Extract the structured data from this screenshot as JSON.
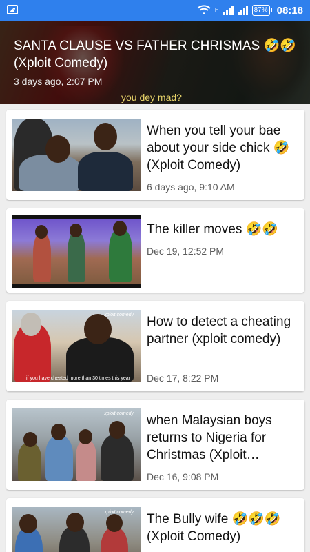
{
  "status_bar": {
    "battery": "87%",
    "time": "08:18",
    "network_label": "H"
  },
  "featured": {
    "title": "SANTA CLAUSE  VS  FATHER CHRISMAS 🤣🤣 (Xploit Comedy)",
    "time": "3 days ago, 2:07 PM",
    "caption": "you dey mad?"
  },
  "videos": [
    {
      "title": "When you tell your bae about your side chick 🤣 (Xploit Comedy)",
      "time": "6 days ago, 9:10 AM"
    },
    {
      "title": "The killer moves 🤣🤣",
      "time": "Dec 19, 12:52 PM"
    },
    {
      "title": "How to detect a cheating partner (xploit comedy)",
      "time": "Dec 17, 8:22 PM",
      "thumb_subtitle": "if you have cheated more than 30 times this year",
      "watermark": "xploit comedy"
    },
    {
      "title": "when Malaysian boys returns to Nigeria for Christmas (Xploit Comedy)",
      "time": "Dec 16, 9:08 PM",
      "watermark": "xploit comedy"
    },
    {
      "title": "The Bully wife 🤣🤣🤣 (Xploit Comedy)",
      "time": "",
      "watermark": "xploit comedy"
    }
  ],
  "icons": [
    "gallery-icon",
    "wifi-icon",
    "signal-icon",
    "battery-icon"
  ]
}
